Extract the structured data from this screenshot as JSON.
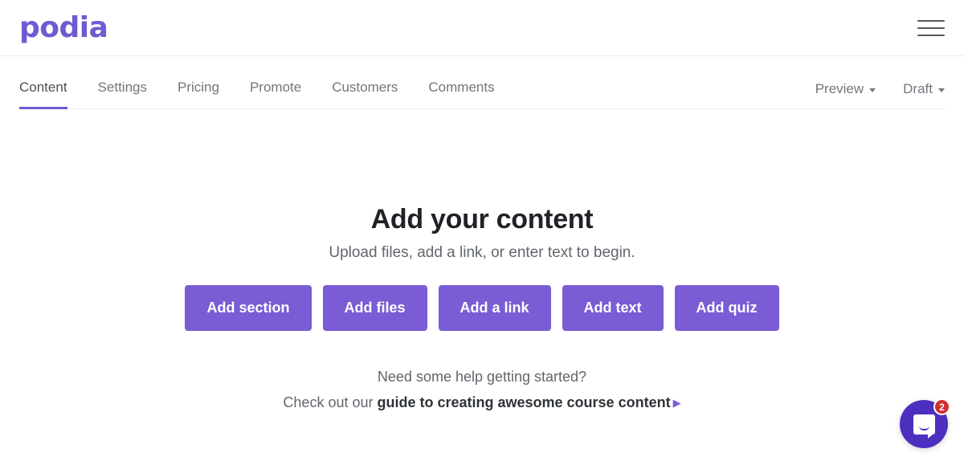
{
  "header": {
    "logo_text": "podia",
    "logo_color": "#6f5ad1",
    "menu_icon": "hamburger-menu-icon"
  },
  "tabs": {
    "items": [
      {
        "label": "Content",
        "active": true
      },
      {
        "label": "Settings",
        "active": false
      },
      {
        "label": "Pricing",
        "active": false
      },
      {
        "label": "Promote",
        "active": false
      },
      {
        "label": "Customers",
        "active": false
      },
      {
        "label": "Comments",
        "active": false
      }
    ],
    "right_menus": [
      {
        "label": "Preview",
        "caret": "chevron-down-icon"
      },
      {
        "label": "Draft",
        "caret": "chevron-down-icon"
      }
    ],
    "active_underline_color": "#6f5ad1"
  },
  "main": {
    "headline": "Add your content",
    "subhead": "Upload files, add a link, or enter text to begin.",
    "buttons": [
      {
        "label": "Add section"
      },
      {
        "label": "Add files"
      },
      {
        "label": "Add a link"
      },
      {
        "label": "Add text"
      },
      {
        "label": "Add quiz"
      }
    ],
    "button_color": "#7a5cd4",
    "help": {
      "line1": "Need some help getting started?",
      "line2_prefix": "Check out our ",
      "link_text": "guide to creating awesome course content",
      "link_arrow": "▶"
    }
  },
  "chat": {
    "icon": "chat-bubble-icon",
    "badge_count": "2",
    "badge_color": "#d32d2f",
    "launcher_color": "#4c2fbe"
  }
}
